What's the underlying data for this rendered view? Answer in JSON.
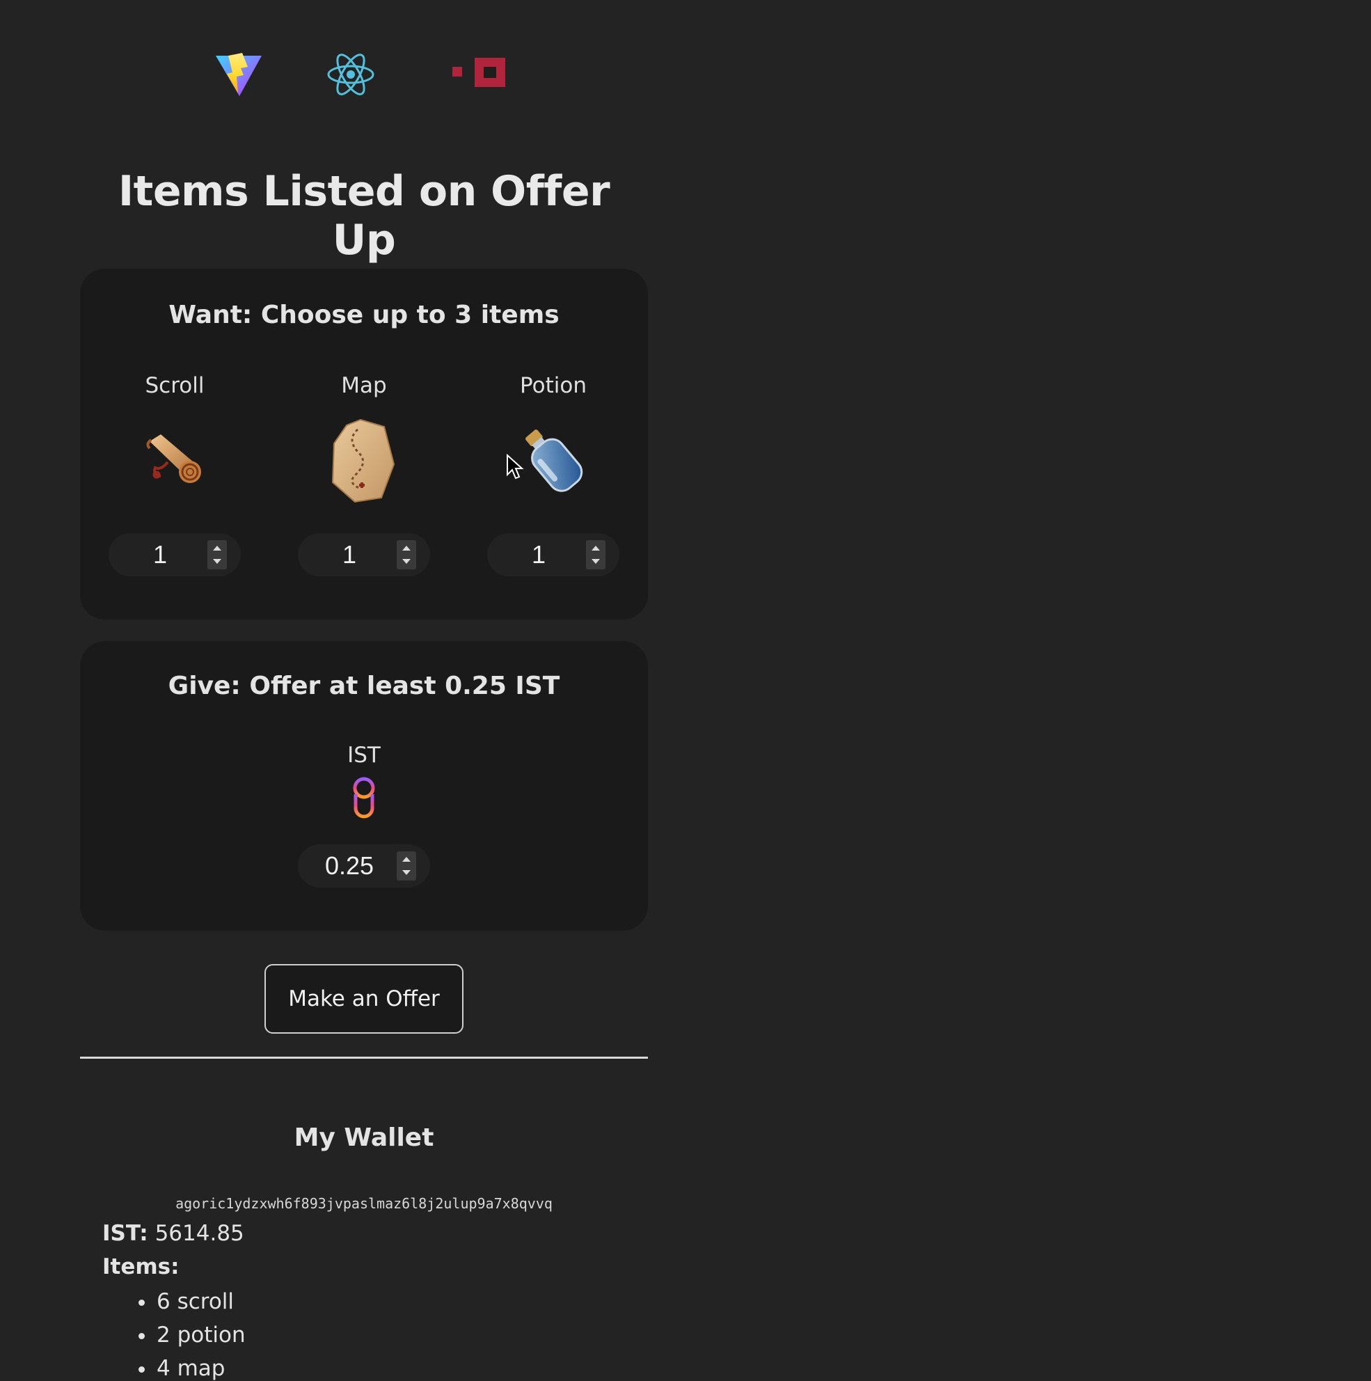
{
  "page": {
    "title": "Items Listed on Offer Up"
  },
  "logos": [
    {
      "name": "vite-logo"
    },
    {
      "name": "react-logo"
    },
    {
      "name": "agoric-logo"
    }
  ],
  "want": {
    "title": "Want: Choose up to 3 items",
    "items": [
      {
        "name": "Scroll",
        "icon": "scroll-icon",
        "quantity": "1"
      },
      {
        "name": "Map",
        "icon": "map-icon",
        "quantity": "1"
      },
      {
        "name": "Potion",
        "icon": "potion-icon",
        "quantity": "1"
      }
    ]
  },
  "give": {
    "title": "Give: Offer at least 0.25 IST",
    "item": {
      "name": "IST",
      "icon": "ist-icon",
      "amount": "0.25"
    }
  },
  "actions": {
    "make_offer_label": "Make an Offer"
  },
  "wallet": {
    "title": "My Wallet",
    "address": "agoric1ydzxwh6f893jvpaslmaz6l8j2ulup9a7x8qvvq",
    "ist_label": "IST:",
    "ist_balance": "5614.85",
    "items_label": "Items:",
    "items": [
      "6 scroll",
      "2 potion",
      "4 map"
    ]
  },
  "colors": {
    "background": "#232323",
    "card": "#1a1a1a",
    "react": "#53c1de",
    "agoric": "#b0253c"
  }
}
